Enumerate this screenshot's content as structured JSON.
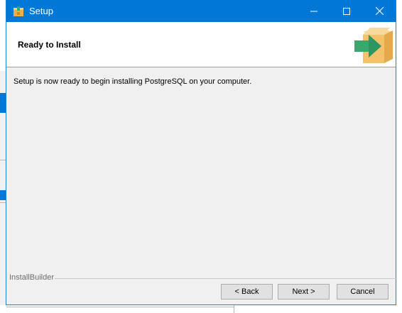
{
  "window": {
    "title": "Setup"
  },
  "header": {
    "title": "Ready to Install"
  },
  "body": {
    "message": "Setup is now ready to begin installing PostgreSQL on your computer."
  },
  "footer": {
    "brand": "InstallBuilder"
  },
  "buttons": {
    "back": "< Back",
    "next": "Next >",
    "cancel": "Cancel"
  },
  "colors": {
    "titlebar": "#0078d7",
    "dialog_bg": "#f0f0f0",
    "header_bg": "#ffffff",
    "logo_box": "#f4c26a",
    "logo_arrow": "#3aa76d"
  },
  "icons": {
    "app": "package-box-icon",
    "minimize": "minimize-icon",
    "maximize": "maximize-icon",
    "close": "close-icon",
    "logo": "box-arrow-icon"
  }
}
